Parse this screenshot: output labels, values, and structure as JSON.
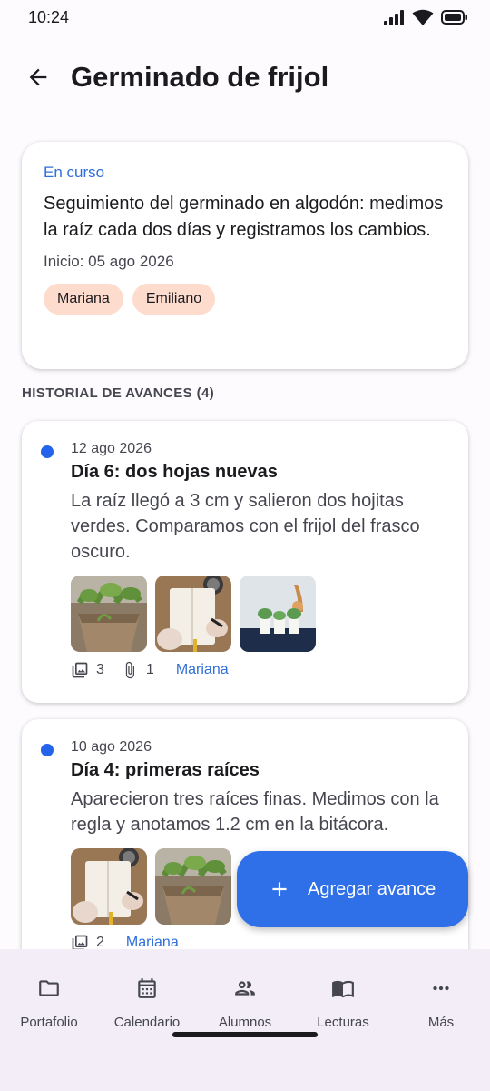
{
  "status_bar": {
    "time": "10:24"
  },
  "app_bar": {
    "title": "Germinado de frijol"
  },
  "summary": {
    "status": "En curso",
    "description": "Seguimiento del germinado en algodón: medimos la raíz cada dos días y registramos los cambios.",
    "start_date": "Inicio: 05 ago 2026",
    "students": [
      "Mariana",
      "Emiliano"
    ]
  },
  "history": {
    "title": "HISTORIAL DE AVANCES (4)",
    "entries": [
      {
        "date": "12 ago 2026",
        "title": "Día 6: dos hojas nuevas",
        "text": "La raíz llegó a 3 cm y salieron dos hojitas verdes. Comparamos con el frijol del frasco oscuro.",
        "photos": [
          "seedlings-in-pot",
          "hands-writing-notebook",
          "plants-in-cups"
        ],
        "photo_count": "3",
        "attachment_count": "1",
        "author": "Mariana"
      },
      {
        "date": "10 ago 2026",
        "title": "Día 4: primeras raíces",
        "text": "Aparecieron tres raíces finas. Medimos con la regla y anotamos 1.2 cm en la bitácora.",
        "photos": [
          "hands-writing-notebook",
          "seedlings-in-pot"
        ],
        "photo_count": "2",
        "author": "Mariana"
      }
    ]
  },
  "fab": {
    "label": "Agregar avance"
  },
  "nav": {
    "items": [
      {
        "label": "Portafolio",
        "icon": "folder-icon"
      },
      {
        "label": "Calendario",
        "icon": "calendar-icon"
      },
      {
        "label": "Alumnos",
        "icon": "people-icon"
      },
      {
        "label": "Lecturas",
        "icon": "book-icon"
      },
      {
        "label": "Más",
        "icon": "more-icon"
      }
    ]
  },
  "colors": {
    "accent": "#2f6fe8",
    "chip": "#fddbcd",
    "link": "#2f6fd9"
  }
}
